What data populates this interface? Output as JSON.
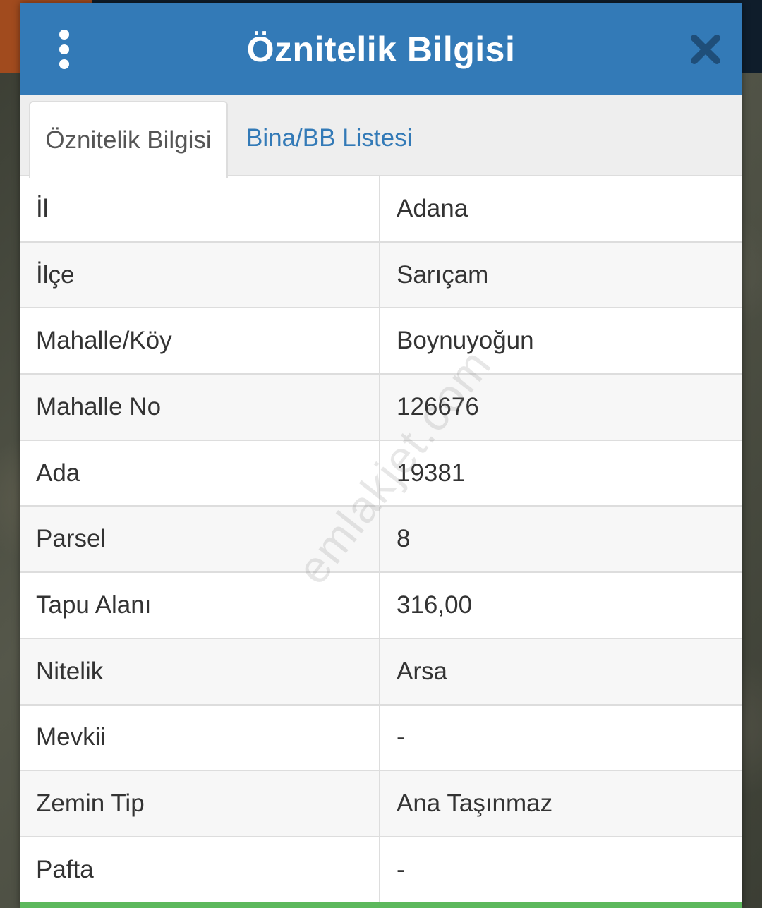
{
  "modal": {
    "title": "Öznitelik Bilgisi",
    "menu_icon": "more-vertical-icon",
    "close_icon": "close-icon"
  },
  "tabs": [
    {
      "label": "Öznitelik Bilgisi",
      "active": true
    },
    {
      "label": "Bina/BB Listesi",
      "active": false
    }
  ],
  "rows": [
    {
      "key": "İl",
      "value": "Adana"
    },
    {
      "key": "İlçe",
      "value": "Sarıçam"
    },
    {
      "key": "Mahalle/Köy",
      "value": "Boynuyoğun"
    },
    {
      "key": "Mahalle No",
      "value": "126676"
    },
    {
      "key": "Ada",
      "value": "19381"
    },
    {
      "key": "Parsel",
      "value": "8"
    },
    {
      "key": "Tapu Alanı",
      "value": "316,00"
    },
    {
      "key": "Nitelik",
      "value": "Arsa"
    },
    {
      "key": "Mevkii",
      "value": "-"
    },
    {
      "key": "Zemin Tip",
      "value": "Ana Taşınmaz"
    },
    {
      "key": "Pafta",
      "value": "-"
    }
  ],
  "watermark": "emlakjet.com",
  "colors": {
    "header": "#337ab7",
    "tab_active_text": "#555555",
    "tab_link": "#337ab7",
    "footer_accent": "#5cb85c"
  }
}
